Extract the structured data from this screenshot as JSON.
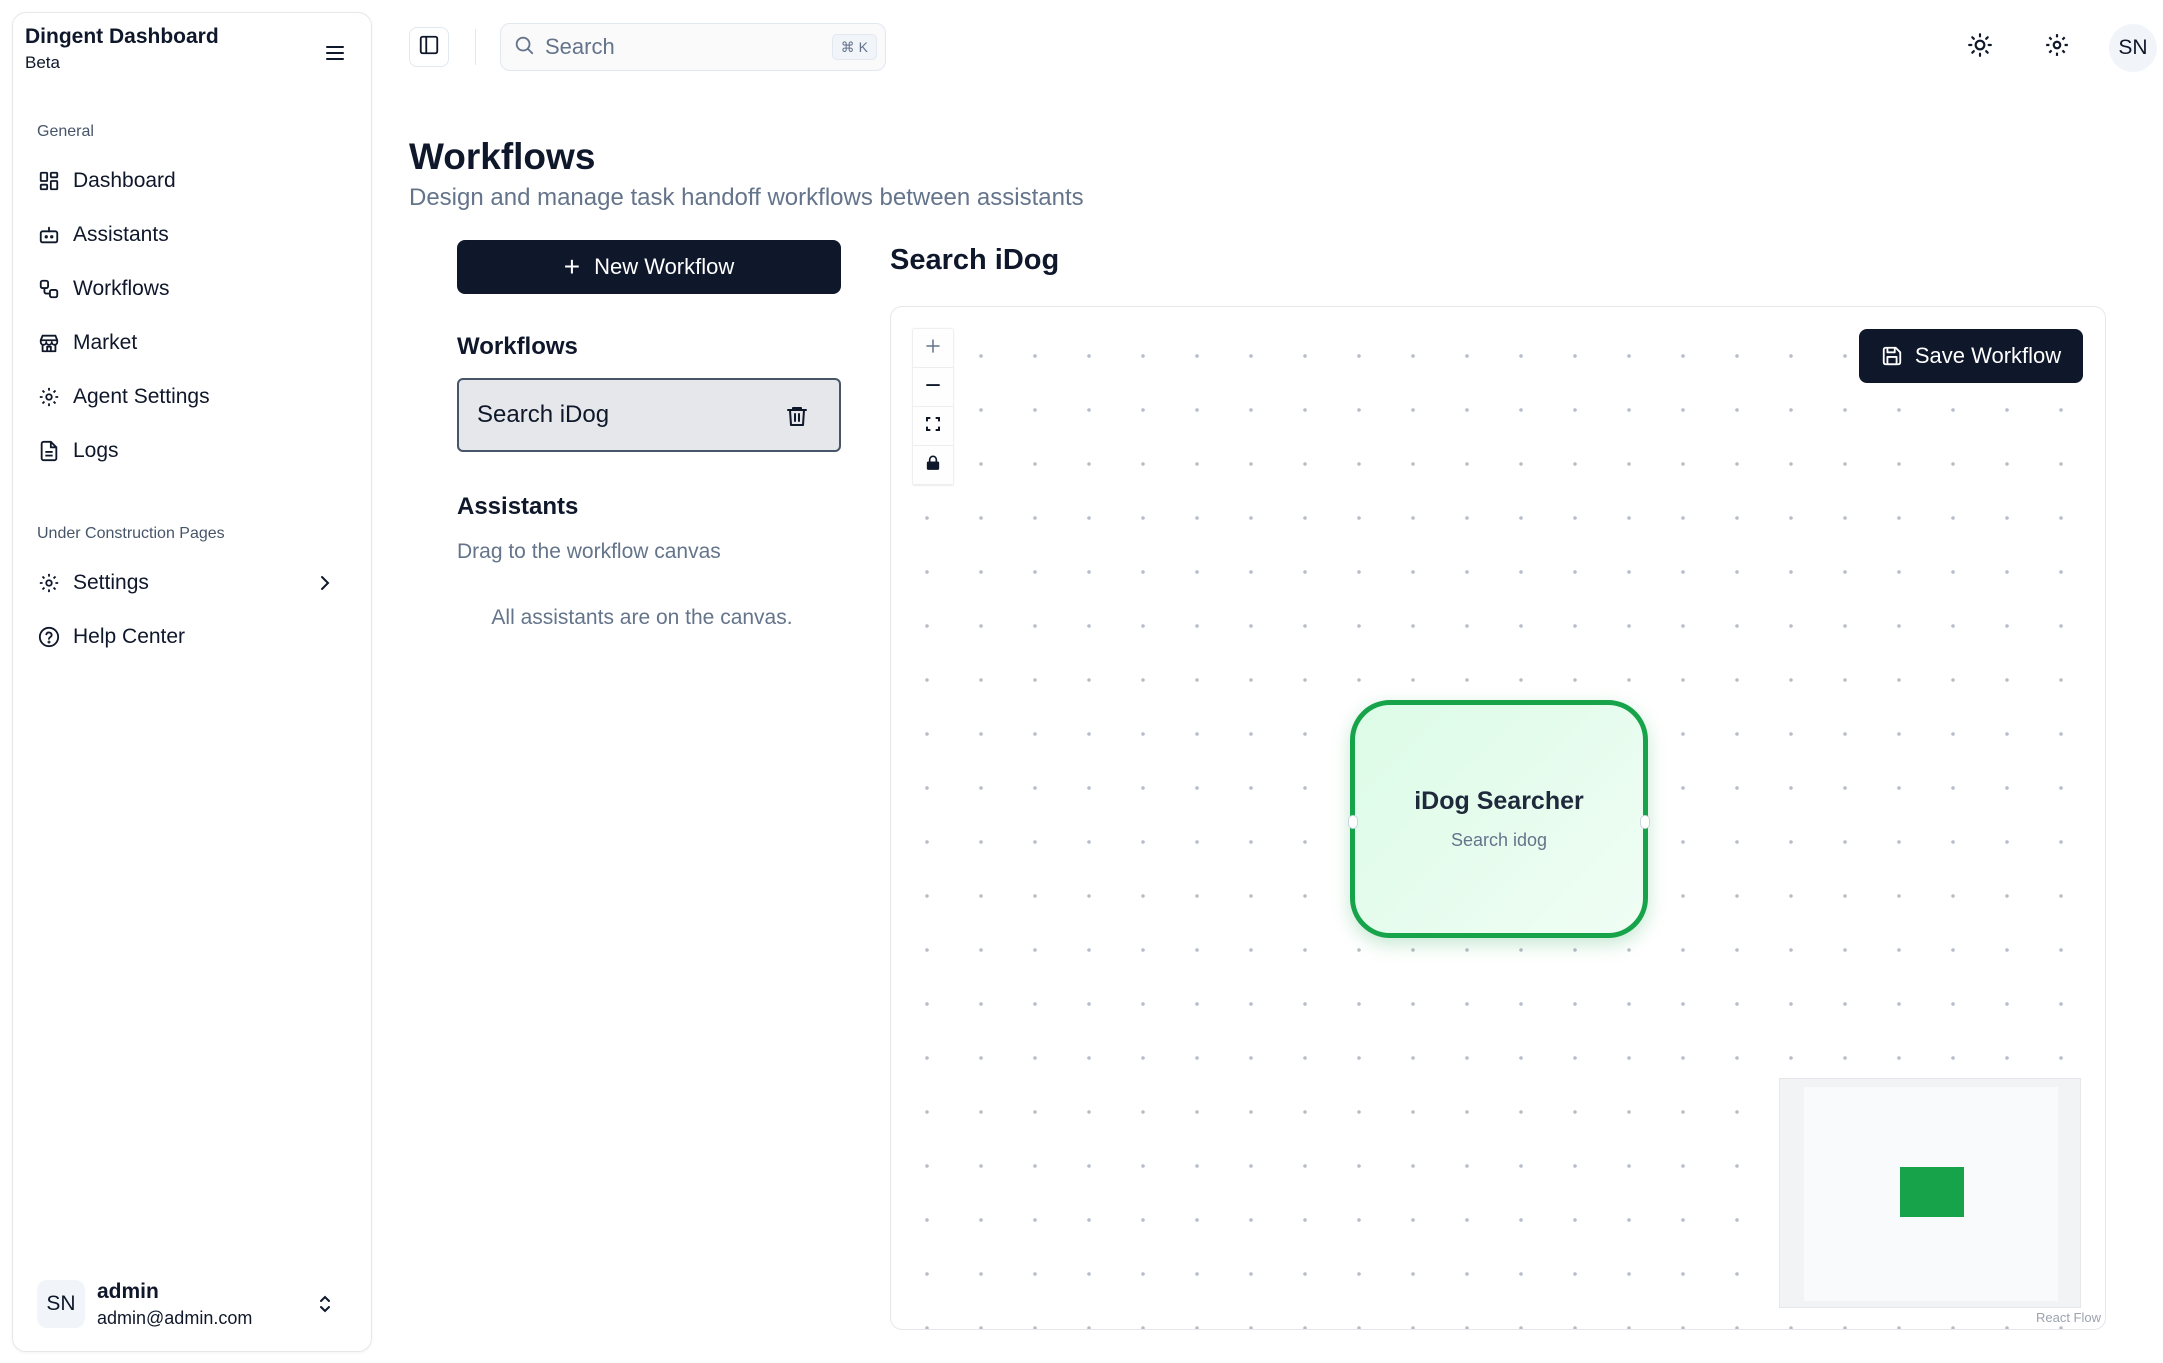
{
  "brand": {
    "title": "Dingent Dashboard",
    "subtitle": "Beta"
  },
  "sidebar": {
    "groups": [
      {
        "label": "General",
        "items": [
          {
            "label": "Dashboard",
            "icon": "dashboard-icon"
          },
          {
            "label": "Assistants",
            "icon": "bot-icon"
          },
          {
            "label": "Workflows",
            "icon": "workflow-icon"
          },
          {
            "label": "Market",
            "icon": "store-icon"
          },
          {
            "label": "Agent Settings",
            "icon": "gear-icon"
          },
          {
            "label": "Logs",
            "icon": "file-text-icon"
          }
        ]
      },
      {
        "label": "Under Construction Pages",
        "items": [
          {
            "label": "Settings",
            "icon": "gear-icon"
          },
          {
            "label": "Help Center",
            "icon": "help-circle-icon"
          }
        ]
      }
    ],
    "user": {
      "initials": "SN",
      "name": "admin",
      "email": "admin@admin.com"
    }
  },
  "topbar": {
    "search_placeholder": "Search",
    "search_shortcut": "⌘ K",
    "avatar_initials": "SN"
  },
  "page": {
    "title": "Workflows",
    "subtitle": "Design and manage task handoff workflows between assistants"
  },
  "left_panel": {
    "new_workflow_label": "New Workflow",
    "workflows_heading": "Workflows",
    "workflows": [
      {
        "name": "Search iDog"
      }
    ],
    "assistants_heading": "Assistants",
    "assistants_hint": "Drag to the workflow canvas",
    "assistants_empty": "All assistants are on the canvas."
  },
  "canvas": {
    "title": "Search iDog",
    "save_label": "Save Workflow",
    "node": {
      "title": "iDog Searcher",
      "subtitle": "Search idog"
    },
    "attribution": "React Flow",
    "accent_color": "#16a34a"
  }
}
